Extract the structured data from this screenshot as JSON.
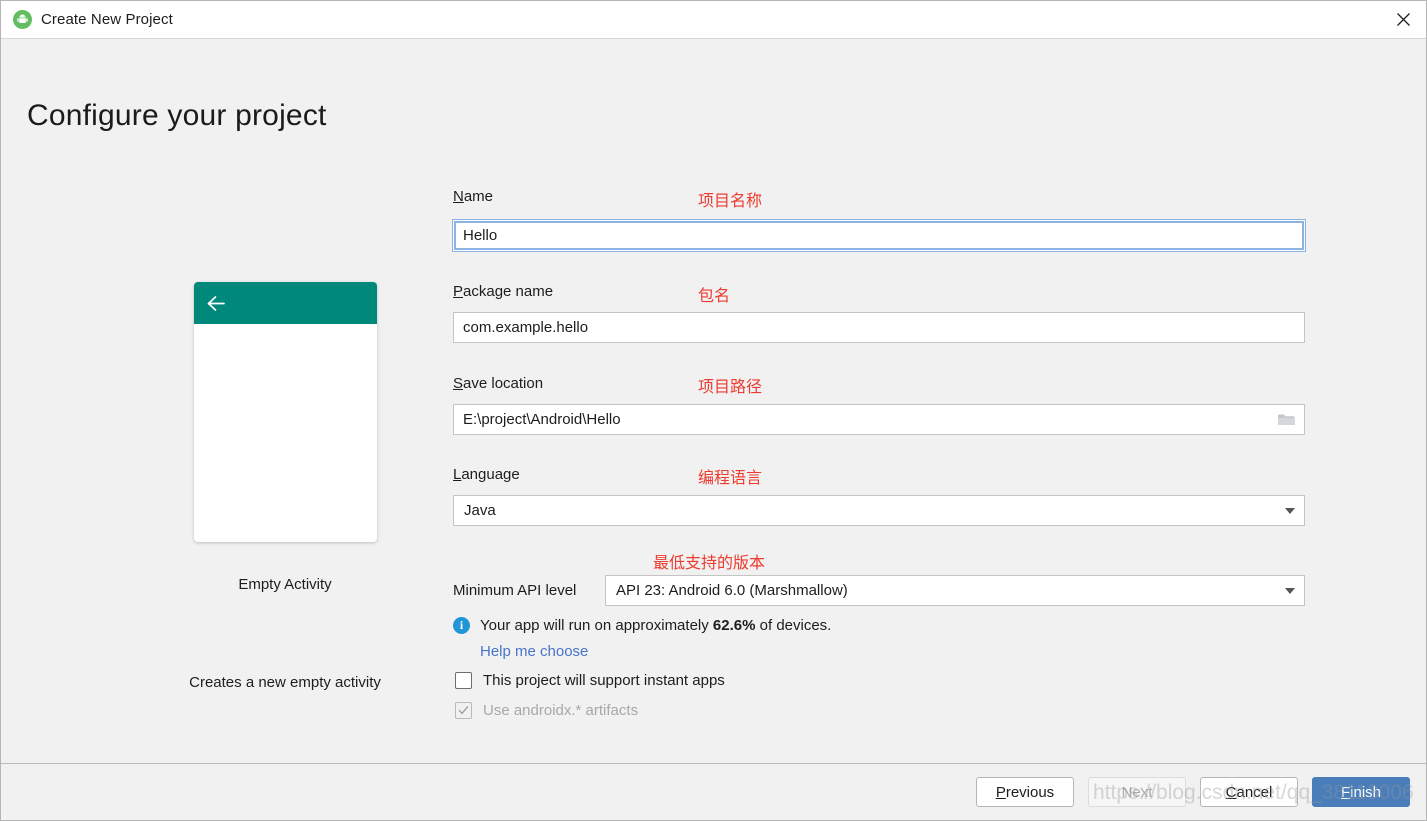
{
  "window": {
    "title": "Create New Project",
    "app_icon": "android-logo-icon",
    "close_icon": "close-icon"
  },
  "page": {
    "heading": "Configure your project"
  },
  "preview": {
    "template_name": "Empty Activity",
    "description": "Creates a new empty activity",
    "appbar_color": "#00897b",
    "back_icon": "arrow-left-icon"
  },
  "form": {
    "name": {
      "label": "Name",
      "mnemonic": "N",
      "label_rest": "ame",
      "annotation": "项目名称",
      "value": "Hello",
      "focused": true
    },
    "package": {
      "label": "Package name",
      "mnemonic": "P",
      "label_rest": "ackage name",
      "annotation": "包名",
      "value": "com.example.hello"
    },
    "save_location": {
      "label": "Save location",
      "mnemonic": "S",
      "label_rest": "ave location",
      "annotation": "项目路径",
      "value": "E:\\project\\Android\\Hello",
      "browse_icon": "folder-icon"
    },
    "language": {
      "label": "Language",
      "mnemonic": "L",
      "label_rest": "anguage",
      "annotation": "编程语言",
      "value": "Java",
      "caret_icon": "chevron-down-icon"
    },
    "min_api": {
      "label": "Minimum API level",
      "annotation": "最低支持的版本",
      "value": "API 23: Android 6.0 (Marshmallow)",
      "caret_icon": "chevron-down-icon"
    },
    "device_info": {
      "icon": "info-icon",
      "text_before": "Your app will run on approximately ",
      "percent": "62.6%",
      "text_after": " of devices."
    },
    "help_link": "Help me choose",
    "instant_apps": {
      "label": "This project will support instant apps",
      "checked": false
    },
    "androidx": {
      "label": "Use androidx.* artifacts",
      "checked": true,
      "disabled": true
    }
  },
  "footer": {
    "previous": "Previous",
    "previous_mnemonic": "P",
    "previous_rest": "revious",
    "next": "Next",
    "next_disabled": true,
    "cancel": "Cancel",
    "cancel_mnemonic": "C",
    "cancel_rest": "ancel",
    "finish": "Finish",
    "finish_mnemonic": "F",
    "finish_rest": "inish",
    "finish_color": "#4a7ebb"
  },
  "watermark": "https://blog.csdn.net/qq_38113006"
}
